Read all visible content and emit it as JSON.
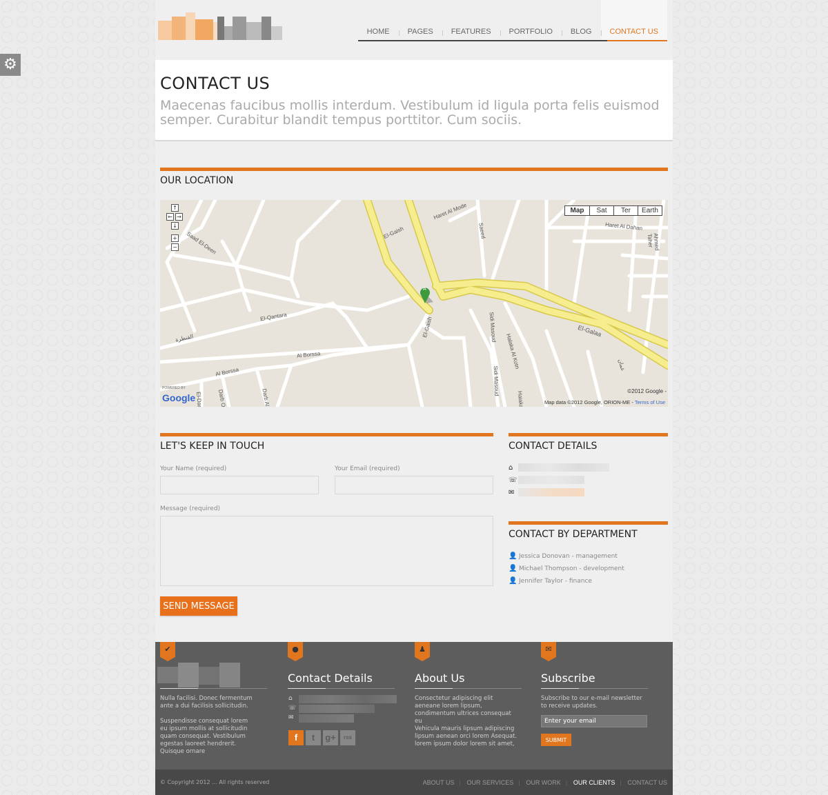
{
  "nav": {
    "items": [
      "HOME",
      "PAGES",
      "FEATURES",
      "PORTFOLIO",
      "BLOG",
      "CONTACT US"
    ],
    "active_index": 5
  },
  "hero": {
    "title": "CONTACT US",
    "subtitle": "Maecenas faucibus mollis interdum. Vestibulum id ligula porta felis euismod semper. Curabitur blandit tempus porttitor. Cum sociis."
  },
  "location": {
    "title": "OUR LOCATION",
    "map_types": [
      "Map",
      "Sat",
      "Ter",
      "Earth"
    ],
    "labels": {
      "el_galaa": "El-Galaa",
      "el_qantara": "El-Qantara",
      "al_borssa": "Al Borssa",
      "al_borssa2": "Al Borssa",
      "el_gaish": "El-Gaish",
      "el_gaish2": "El-Gaish",
      "haret_al_mode": "Haret Al Mode",
      "haret_al_dahan": "Haret Al Dahan",
      "saad_el_deen": "Saad El-Deen",
      "sidi_masoud": "Sidi Masoud",
      "sidi_masoud2": "Sidi Masoud",
      "halaka_al_kotn": "Halaka Al Kotn",
      "saeed": "Saeed",
      "ahmed_taher": "Ahmed Taher",
      "darb_al": "Darb Al",
      "darb_ol": "Darb Ol",
      "el_dar": "El-Dar",
      "haiaka": "Haiaka",
      "arabic1": "القنطرة",
      "arabic2": "عمان"
    },
    "marker": "A",
    "powered_by": "POWERED BY",
    "google": "Google",
    "copyright": "©2012 Google -",
    "attribution": "Map data ©2012 Google, ORION-ME -",
    "terms": "Terms of Use"
  },
  "form": {
    "title": "LET'S KEEP IN TOUCH",
    "name_label": "Your Name (required)",
    "email_label": "Your Email (required)",
    "message_label": "Message (required)",
    "send_label": "SEND MESSAGE"
  },
  "contact_details": {
    "title": "CONTACT DETAILS",
    "icons": [
      "home-icon",
      "phone-icon",
      "mail-icon"
    ]
  },
  "department": {
    "title": "CONTACT BY DEPARTMENT",
    "people": [
      "Jessica Donovan - management",
      "Michael Thompson - development",
      "Jennifer Taylor - finance"
    ]
  },
  "footer": {
    "about_text1": "Nulla facilisi. Donec fermentum ante a dui facilisis sollicitudin.",
    "about_text2": "Suspendisse consequat lorem eu ipsum mollis at sollicitudin quam consequat. Vestibulum egestas laoreet hendrerit. Quisque ornare",
    "contact_title": "Contact Details",
    "about_title": "About Us",
    "about_us_text1": "Consectetur adipiscing elit aeneane lorem lipsum, condimentum ultrices consequat eu",
    "about_us_text2": "Vehicula mauris lipsum adipiscing lipsum aenean orci lorem Asequat. lorem ipsum dolor lorem sit amet,",
    "subscribe_title": "Subscribe",
    "subscribe_text": "Subscribe to our e-mail newsletter to receive updates.",
    "email_placeholder": "Enter your email",
    "submit_label": "SUBMIT",
    "social": [
      "f",
      "t",
      "g+",
      "rss"
    ]
  },
  "bottom": {
    "copyright": "© Copyright 2012 ... All rights reserved",
    "links": [
      "ABOUT US",
      "OUR SERVICES",
      "OUR WORK",
      "OUR CLIENTS",
      "CONTACT US"
    ],
    "active_index": 3
  },
  "colors": {
    "accent": "#e2761f",
    "footer_bg": "#5d5d5d",
    "bottom_bg": "#484848"
  }
}
